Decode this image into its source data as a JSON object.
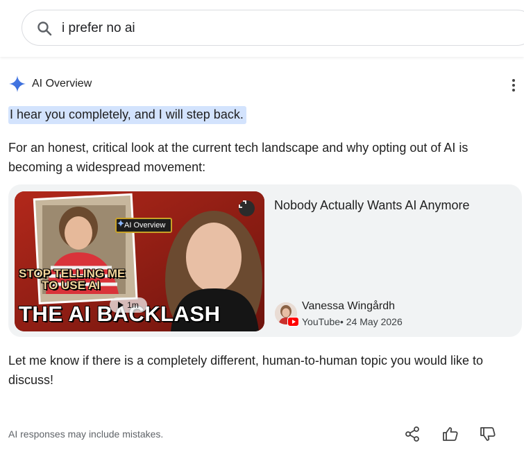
{
  "search": {
    "query": "i prefer no ai",
    "icon": "search-icon"
  },
  "ai_overview": {
    "label": "AI Overview",
    "icon": "gemini-sparkle-icon",
    "menu_icon": "more-vert-icon",
    "highlight": "I hear you completely, and I will step back.",
    "intro": "For an honest, critical look at the current tech landscape and why opting out of AI is becoming a widespread movement:",
    "closing": "Let me know if there is a completely different, human-to-human topic you would like to discuss!",
    "disclaimer": "AI responses may include mistakes."
  },
  "video": {
    "title": "Nobody Actually Wants AI Anymore",
    "channel": "Vanessa Wingårdh",
    "source_date": "YouTube• 24 May 2026",
    "duration": "1m",
    "thumb_badge": "AI Overview",
    "thumb_line1": "STOP TELLING ME",
    "thumb_line2": "TO USE AI",
    "thumb_headline": "THE AI BACKLASH",
    "expand_icon": "expand-icon",
    "platform_icon": "youtube-icon"
  },
  "actions": {
    "share_icon": "share-icon",
    "thumbs_up_icon": "thumbs-up-icon",
    "thumbs_down_icon": "thumbs-down-icon"
  },
  "colors": {
    "highlight_bg": "#d3e3fd",
    "card_bg": "#f1f3f4",
    "youtube_red": "#ff0000"
  }
}
